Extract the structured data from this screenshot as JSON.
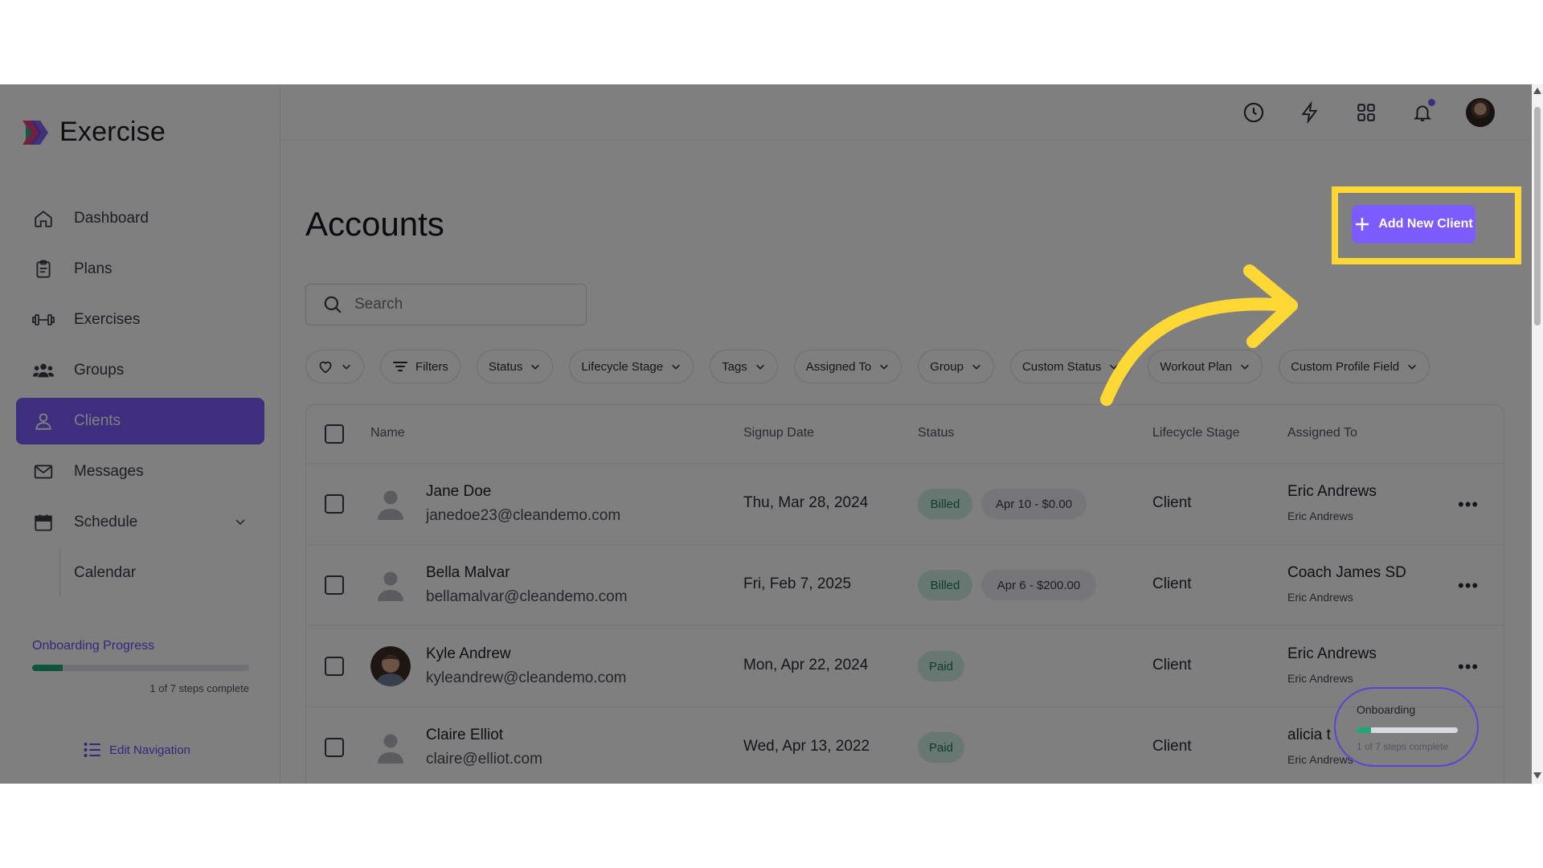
{
  "app": {
    "name": "Exercise"
  },
  "sidebar": {
    "items": [
      {
        "label": "Dashboard",
        "icon": "home-icon"
      },
      {
        "label": "Plans",
        "icon": "clipboard-icon"
      },
      {
        "label": "Exercises",
        "icon": "dumbbell-icon"
      },
      {
        "label": "Groups",
        "icon": "users-icon"
      },
      {
        "label": "Clients",
        "icon": "user-icon",
        "active": true
      },
      {
        "label": "Messages",
        "icon": "mail-icon"
      },
      {
        "label": "Schedule",
        "icon": "calendar-icon"
      }
    ],
    "sub_items": [
      {
        "label": "Calendar"
      }
    ],
    "onboarding": {
      "title": "Onboarding Progress",
      "progress": 0.14,
      "steps_text": "1 of 7 steps complete"
    },
    "edit_navigation": "Edit Navigation"
  },
  "topbar": {
    "icons": [
      "clock-icon",
      "bolt-icon",
      "grid-icon",
      "bell-icon",
      "avatar"
    ],
    "notification_dot_color": "#7c5cff"
  },
  "main": {
    "title": "Accounts",
    "add_button": "Add New Client",
    "search": {
      "placeholder": "Search",
      "value": ""
    },
    "filters": [
      "Filters",
      "Status",
      "Lifecycle Stage",
      "Tags",
      "Assigned To",
      "Group",
      "Custom Status",
      "Workout Plan",
      "Custom Profile Field"
    ],
    "table": {
      "columns": [
        "Name",
        "Signup Date",
        "Status",
        "Lifecycle Stage",
        "Assigned To"
      ],
      "rows": [
        {
          "name": "Jane Doe",
          "email": "janedoe23@cleandemo.com",
          "signup": "Thu, Mar 28, 2024",
          "status": "Billed",
          "billing": "Apr 10 - $0.00",
          "stage": "Client",
          "assigned": "Eric Andrews",
          "assigned_sub": "Eric Andrews",
          "avatar": "placeholder"
        },
        {
          "name": "Bella Malvar",
          "email": "bellamalvar@cleandemo.com",
          "signup": "Fri, Feb 7, 2025",
          "status": "Billed",
          "billing": "Apr 6 - $200.00",
          "stage": "Client",
          "assigned": "Coach James SD",
          "assigned_sub": "Eric Andrews",
          "avatar": "placeholder"
        },
        {
          "name": "Kyle Andrew",
          "email": "kyleandrew@cleandemo.com",
          "signup": "Mon, Apr 22, 2024",
          "status": "Paid",
          "billing": "",
          "stage": "Client",
          "assigned": "Eric Andrews",
          "assigned_sub": "Eric Andrews",
          "avatar": "photo"
        },
        {
          "name": "Claire Elliot",
          "email": "claire@elliot.com",
          "signup": "Wed, Apr 13, 2022",
          "status": "Paid",
          "billing": "",
          "stage": "Client",
          "assigned": "alicia t",
          "assigned_sub": "Eric Andrews",
          "avatar": "placeholder"
        }
      ]
    },
    "onboarding_widget": {
      "title": "Onboarding",
      "progress": 0.14,
      "steps_text": "1 of 7 steps complete"
    }
  },
  "colors": {
    "accent": "#7c5cff",
    "highlight": "#ffd835",
    "success": "#1ea87a"
  }
}
